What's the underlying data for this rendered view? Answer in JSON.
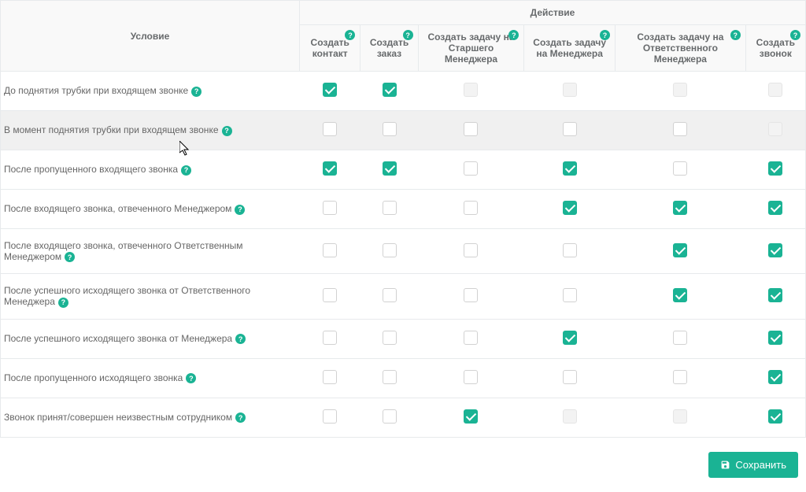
{
  "headers": {
    "condition": "Условие",
    "action_group": "Действие",
    "actions": [
      "Создать контакт",
      "Создать заказ",
      "Создать задачу на Старшего Менеджера",
      "Создать задачу на Менеджера",
      "Создать задачу на Ответственного Менеджера",
      "Создать звонок"
    ]
  },
  "rows": [
    {
      "label": "До поднятия трубки при входящем звонке",
      "highlighted": false,
      "cells": [
        {
          "checked": true,
          "disabled": false
        },
        {
          "checked": true,
          "disabled": false
        },
        {
          "checked": false,
          "disabled": true
        },
        {
          "checked": false,
          "disabled": true
        },
        {
          "checked": false,
          "disabled": true
        },
        {
          "checked": false,
          "disabled": true
        }
      ]
    },
    {
      "label": "В момент поднятия трубки при входящем звонке",
      "highlighted": true,
      "cells": [
        {
          "checked": false,
          "disabled": false
        },
        {
          "checked": false,
          "disabled": false
        },
        {
          "checked": false,
          "disabled": false
        },
        {
          "checked": false,
          "disabled": false
        },
        {
          "checked": false,
          "disabled": false
        },
        {
          "checked": false,
          "disabled": true
        }
      ]
    },
    {
      "label": "После пропущенного входящего звонка",
      "highlighted": false,
      "cells": [
        {
          "checked": true,
          "disabled": false
        },
        {
          "checked": true,
          "disabled": false
        },
        {
          "checked": false,
          "disabled": false
        },
        {
          "checked": true,
          "disabled": false
        },
        {
          "checked": false,
          "disabled": false
        },
        {
          "checked": true,
          "disabled": false
        }
      ]
    },
    {
      "label": "После входящего звонка, отвеченного Менеджером",
      "highlighted": false,
      "cells": [
        {
          "checked": false,
          "disabled": false
        },
        {
          "checked": false,
          "disabled": false
        },
        {
          "checked": false,
          "disabled": false
        },
        {
          "checked": true,
          "disabled": false
        },
        {
          "checked": true,
          "disabled": false
        },
        {
          "checked": true,
          "disabled": false
        }
      ]
    },
    {
      "label": "После входящего звонка, отвеченного Ответственным Менеджером",
      "highlighted": false,
      "cells": [
        {
          "checked": false,
          "disabled": false
        },
        {
          "checked": false,
          "disabled": false
        },
        {
          "checked": false,
          "disabled": false
        },
        {
          "checked": false,
          "disabled": false
        },
        {
          "checked": true,
          "disabled": false
        },
        {
          "checked": true,
          "disabled": false
        }
      ]
    },
    {
      "label": "После успешного исходящего звонка от Ответственного Менеджера",
      "highlighted": false,
      "cells": [
        {
          "checked": false,
          "disabled": false
        },
        {
          "checked": false,
          "disabled": false
        },
        {
          "checked": false,
          "disabled": false
        },
        {
          "checked": false,
          "disabled": false
        },
        {
          "checked": true,
          "disabled": false
        },
        {
          "checked": true,
          "disabled": false
        }
      ]
    },
    {
      "label": "После успешного исходящего звонка от Менеджера",
      "highlighted": false,
      "cells": [
        {
          "checked": false,
          "disabled": false
        },
        {
          "checked": false,
          "disabled": false
        },
        {
          "checked": false,
          "disabled": false
        },
        {
          "checked": true,
          "disabled": false
        },
        {
          "checked": false,
          "disabled": false
        },
        {
          "checked": true,
          "disabled": false
        }
      ]
    },
    {
      "label": "После пропущенного исходящего звонка",
      "highlighted": false,
      "cells": [
        {
          "checked": false,
          "disabled": false
        },
        {
          "checked": false,
          "disabled": false
        },
        {
          "checked": false,
          "disabled": false
        },
        {
          "checked": false,
          "disabled": false
        },
        {
          "checked": false,
          "disabled": false
        },
        {
          "checked": true,
          "disabled": false
        }
      ]
    },
    {
      "label": "Звонок принят/совершен неизвестным сотрудником",
      "highlighted": false,
      "cells": [
        {
          "checked": false,
          "disabled": false
        },
        {
          "checked": false,
          "disabled": false
        },
        {
          "checked": true,
          "disabled": false
        },
        {
          "checked": false,
          "disabled": true
        },
        {
          "checked": false,
          "disabled": true
        },
        {
          "checked": true,
          "disabled": false
        }
      ]
    }
  ],
  "footer": {
    "save_label": "Сохранить"
  }
}
